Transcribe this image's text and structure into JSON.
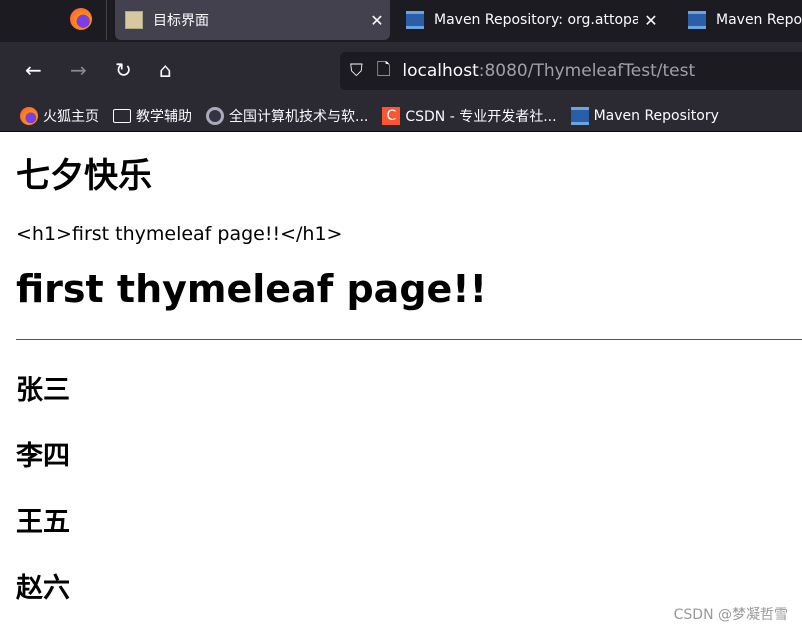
{
  "browser": {
    "tabs": [
      {
        "title": "目标界面",
        "active": true,
        "icon": "tomcat-icon"
      },
      {
        "title": "Maven Repository: org.attopa",
        "active": false,
        "icon": "maven-icon"
      },
      {
        "title": "Maven Repo",
        "active": false,
        "icon": "maven-icon"
      }
    ],
    "url_host": "localhost",
    "url_rest": ":8080/ThymeleafTest/test",
    "bookmarks": [
      {
        "label": "火狐主页",
        "icon": "firefox-icon"
      },
      {
        "label": "教学辅助",
        "icon": "folder-icon"
      },
      {
        "label": "全国计算机技术与软...",
        "icon": "site-icon"
      },
      {
        "label": "CSDN - 专业开发者社...",
        "icon": "csdn-icon"
      },
      {
        "label": "Maven Repository",
        "icon": "maven-icon"
      }
    ]
  },
  "page": {
    "title": "七夕快乐",
    "raw_text": "<h1>first thymeleaf page!!</h1>",
    "heading": "first thymeleaf page!!",
    "names": [
      "张三",
      "李四",
      "王五",
      "赵六"
    ]
  },
  "watermark": "CSDN @梦凝哲雪"
}
